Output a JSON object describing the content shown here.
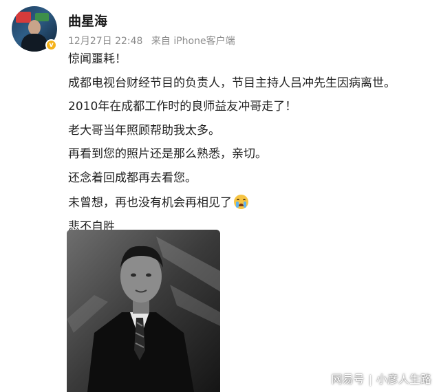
{
  "post": {
    "author": {
      "name": "曲星海",
      "verified_badge": "v"
    },
    "meta": {
      "time": "12月27日 22:48",
      "source": "来自 iPhone客户端"
    },
    "lines": [
      "惊闻噩耗！",
      "成都电视台财经节目的负责人，节目主持人吕冲先生因病离世。",
      "2010年在成都工作时的良师益友冲哥走了！",
      "老大哥当年照顾帮助我太多。",
      "再看到您的照片还是那么熟悉，亲切。",
      "还念着回成都再去看您。",
      "未曾想，再也没有机会再相见了",
      "悲不自胜"
    ],
    "emoji": "crying-face-emoji"
  },
  "watermark": {
    "platform": "网易号",
    "separator": "|",
    "account": "小彦人生路"
  },
  "colors": {
    "text": "#222222",
    "meta": "#8c8c8c",
    "verified": "#f5b21a"
  }
}
